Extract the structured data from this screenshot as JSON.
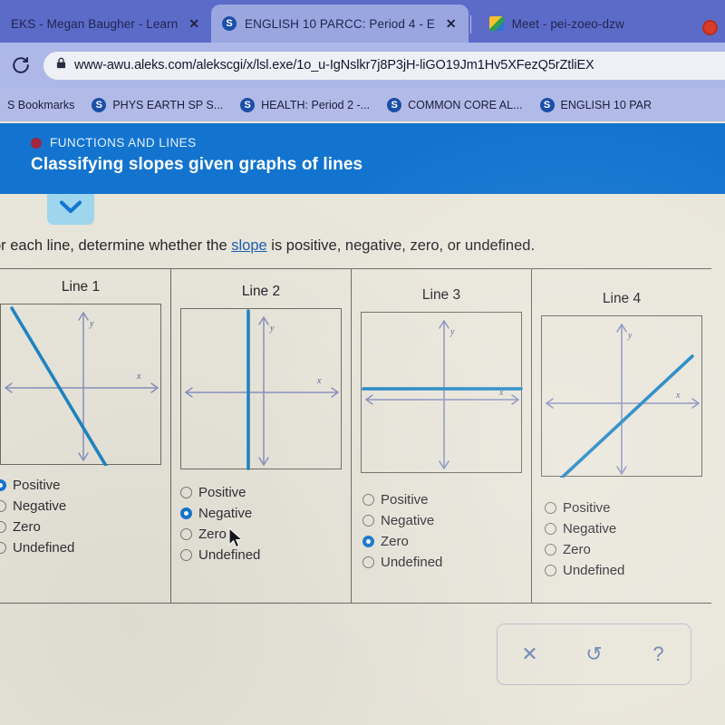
{
  "browser": {
    "tabs": [
      {
        "title": "EKS - Megan Baugher - Learn",
        "favicon": "",
        "close_label": "✕",
        "active": false
      },
      {
        "title": "ENGLISH 10 PARCC: Period 4 - E",
        "favicon": "S",
        "close_label": "✕",
        "active": true
      },
      {
        "title": "Meet - pei-zoeo-dzw",
        "favicon": "meet",
        "close_label": "",
        "active": false
      }
    ],
    "record_indicator": "record-dot",
    "reload_glyph": "⟳",
    "url": "www-awu.aleks.com/alekscgi/x/lsl.exe/1o_u-IgNslkr7j8P3jH-liGO19Jm1Hv5XFezQ5rZtliEX",
    "lock_icon": "lock-icon",
    "bookmarks": [
      {
        "label": "S Bookmarks",
        "favicon": ""
      },
      {
        "label": "PHYS EARTH SP S...",
        "favicon": "S"
      },
      {
        "label": "HEALTH: Period 2 -...",
        "favicon": "S"
      },
      {
        "label": "COMMON CORE AL...",
        "favicon": "S"
      },
      {
        "label": "ENGLISH 10 PAR",
        "favicon": "S"
      }
    ]
  },
  "aleks": {
    "topic_label": "FUNCTIONS AND LINES",
    "lesson_title": "Classifying slopes given graphs of lines",
    "chevron_glyph": "❯",
    "prompt_pre": "or each line, determine whether the ",
    "prompt_keyword": "slope",
    "prompt_post": " is positive, negative, zero, or undefined."
  },
  "columns": [
    {
      "title": "Line 1",
      "graph": {
        "kind": "negative-slope-line",
        "x_label": "x",
        "y_label": "y"
      },
      "options": [
        {
          "label": "Positive",
          "selected": true
        },
        {
          "label": "Negative",
          "selected": false
        },
        {
          "label": "Zero",
          "selected": false
        },
        {
          "label": "Undefined",
          "selected": false
        }
      ]
    },
    {
      "title": "Line 2",
      "graph": {
        "kind": "vertical-line",
        "x_label": "x",
        "y_label": "y"
      },
      "options": [
        {
          "label": "Positive",
          "selected": false
        },
        {
          "label": "Negative",
          "selected": true
        },
        {
          "label": "Zero",
          "selected": false
        },
        {
          "label": "Undefined",
          "selected": false
        }
      ]
    },
    {
      "title": "Line 3",
      "graph": {
        "kind": "horizontal-line",
        "x_label": "x",
        "y_label": "y"
      },
      "options": [
        {
          "label": "Positive",
          "selected": false
        },
        {
          "label": "Negative",
          "selected": false
        },
        {
          "label": "Zero",
          "selected": true
        },
        {
          "label": "Undefined",
          "selected": false
        }
      ]
    },
    {
      "title": "Line 4",
      "graph": {
        "kind": "positive-slope-line",
        "x_label": "x",
        "y_label": "y"
      },
      "options": [
        {
          "label": "Positive",
          "selected": false
        },
        {
          "label": "Negative",
          "selected": false
        },
        {
          "label": "Zero",
          "selected": false
        },
        {
          "label": "Undefined",
          "selected": false
        }
      ]
    }
  ],
  "toolbar": {
    "clear_glyph": "✕",
    "undo_glyph": "↺",
    "help_glyph": "?"
  },
  "colors": {
    "header_blue": "#1374cf",
    "line_blue": "#1f86c4",
    "radio_selected": "#1477d1",
    "topic_dot": "#a3263f",
    "page_bg": "#e9e6db",
    "tab_active": "#9aa6e0"
  }
}
